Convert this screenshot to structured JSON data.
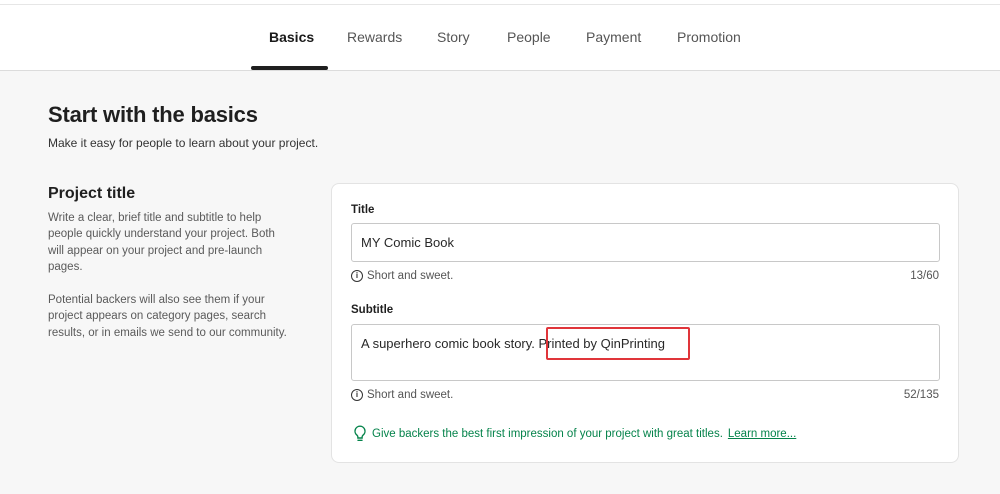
{
  "tabs": [
    {
      "label": "Basics",
      "active": true
    },
    {
      "label": "Rewards"
    },
    {
      "label": "Story"
    },
    {
      "label": "People"
    },
    {
      "label": "Payment"
    },
    {
      "label": "Promotion"
    }
  ],
  "header": {
    "title": "Start with the basics",
    "subtitle": "Make it easy for people to learn about your project."
  },
  "section": {
    "title": "Project title",
    "desc1": "Write a clear, brief title and subtitle to help people quickly understand your project. Both will appear on your project and pre-launch pages.",
    "desc2": "Potential backers will also see them if your project appears on category pages, search results, or in emails we send to our community."
  },
  "form": {
    "title_label": "Title",
    "title_value": "MY Comic Book",
    "title_hint": "Short and sweet.",
    "title_count": "13/60",
    "subtitle_label": "Subtitle",
    "subtitle_value": "A superhero comic book story. Printed by QinPrinting",
    "subtitle_hint": "Short and sweet.",
    "subtitle_count": "52/135"
  },
  "tip": {
    "text": "Give backers the best first impression of your project with great titles.",
    "link": "Learn more..."
  },
  "colors": {
    "accent_green": "#05834b",
    "highlight_red": "#e0353a"
  }
}
